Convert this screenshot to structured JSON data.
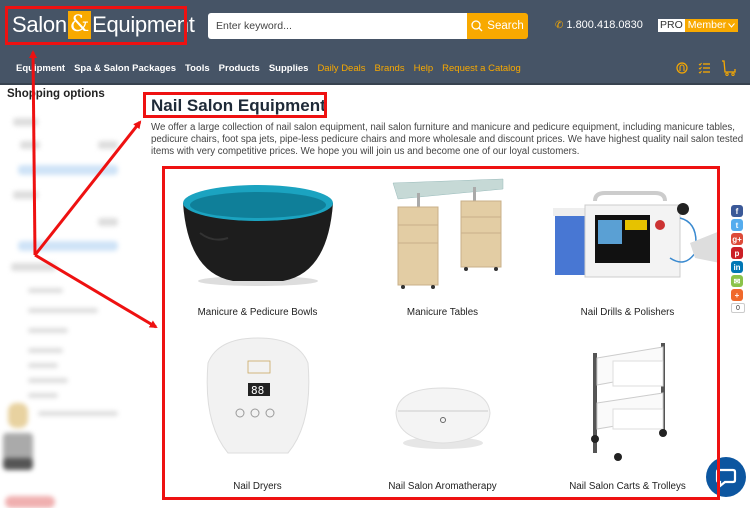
{
  "header": {
    "logo": {
      "left": "Salon",
      "amp": "&",
      "right": "Equipment"
    },
    "search": {
      "placeholder": "Enter keyword...",
      "button_label": "Search"
    },
    "phone": "1.800.418.0830",
    "pro_badge": {
      "pro": "PRO",
      "member": "Member"
    }
  },
  "nav": {
    "items": [
      {
        "label": "Equipment",
        "style": "white"
      },
      {
        "label": "Spa & Salon Packages",
        "style": "white"
      },
      {
        "label": "Tools",
        "style": "white"
      },
      {
        "label": "Products",
        "style": "white"
      },
      {
        "label": "Supplies",
        "style": "white"
      },
      {
        "label": "Daily Deals",
        "style": "orange"
      },
      {
        "label": "Brands",
        "style": "orange"
      },
      {
        "label": "Help",
        "style": "orange"
      },
      {
        "label": "Request a Catalog",
        "style": "orange"
      }
    ],
    "icons": [
      "account-icon",
      "list-icon",
      "cart-icon"
    ]
  },
  "sidebar": {
    "title": "Shopping options"
  },
  "main": {
    "title": "Nail Salon Equipment",
    "description": "We offer a large collection of nail salon equipment, nail salon furniture and manicure and pedicure equipment, including manicure tables, pedicure chairs, foot spa jets, pipe-less pedicure chairs and more wholesale and discount prices. We have highest quality nail salon tested items with very competitive prices. We hope you will join us and become one of our loyal customers.",
    "categories": [
      {
        "label": "Manicure & Pedicure Bowls"
      },
      {
        "label": "Manicure Tables"
      },
      {
        "label": "Nail Drills & Polishers"
      },
      {
        "label": "Nail Dryers"
      },
      {
        "label": "Nail Salon Aromatherapy"
      },
      {
        "label": "Nail Salon Carts & Trolleys"
      }
    ]
  },
  "share": {
    "buttons": [
      {
        "name": "facebook",
        "glyph": "f",
        "color": "#3b5998"
      },
      {
        "name": "twitter",
        "glyph": "t",
        "color": "#55acee"
      },
      {
        "name": "google-plus",
        "glyph": "g+",
        "color": "#dd4b39"
      },
      {
        "name": "pinterest",
        "glyph": "p",
        "color": "#cb2027"
      },
      {
        "name": "linkedin",
        "glyph": "in",
        "color": "#0077b5"
      },
      {
        "name": "email",
        "glyph": "✉",
        "color": "#8bc34a"
      },
      {
        "name": "more",
        "glyph": "+",
        "color": "#f0692b"
      }
    ],
    "count": "0"
  },
  "colors": {
    "header_bg": "#465466",
    "accent": "#f8a900",
    "annotation": "#ee1111"
  }
}
